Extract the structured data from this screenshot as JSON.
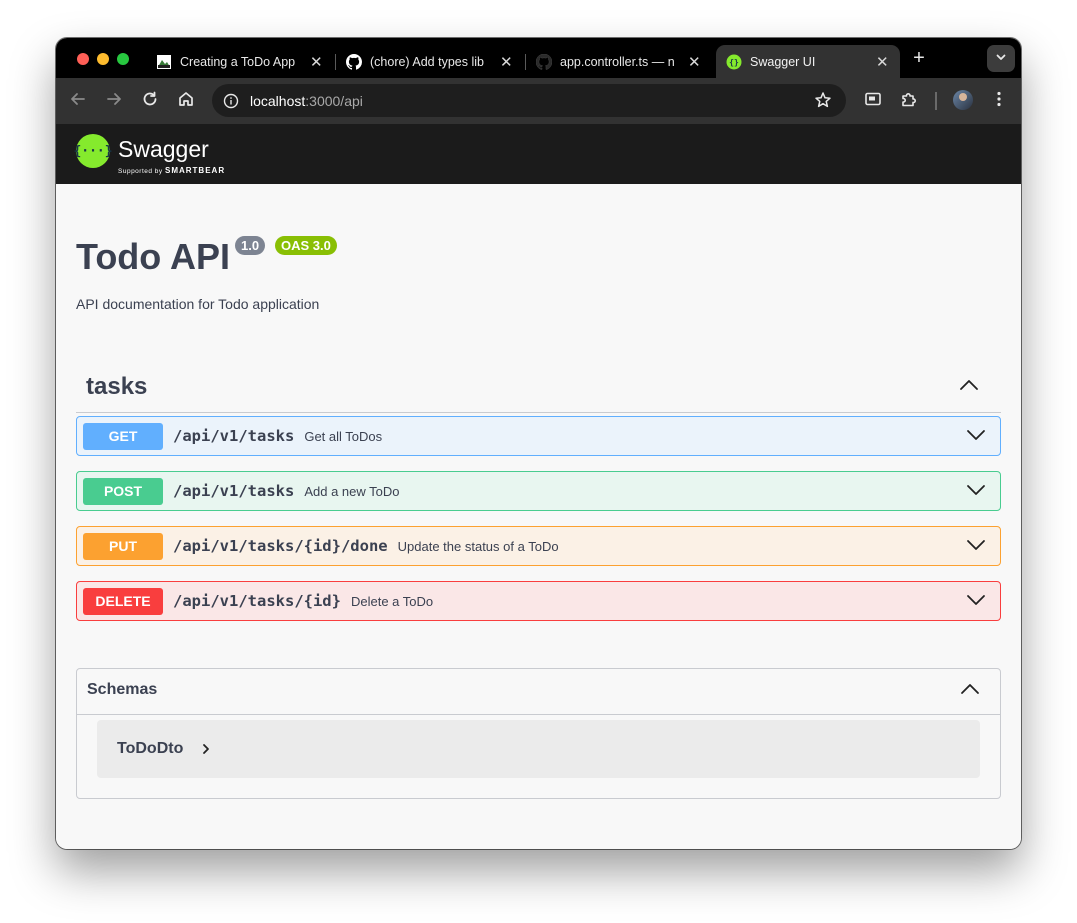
{
  "browser": {
    "tabs": [
      {
        "title": "Creating a ToDo App",
        "favicon": "app-favicon-icon"
      },
      {
        "title": "(chore) Add types lib",
        "favicon": "github-icon"
      },
      {
        "title": "app.controller.ts — n",
        "favicon": "github-icon"
      },
      {
        "title": "Swagger UI",
        "favicon": "swagger-favicon-icon",
        "active": true
      }
    ],
    "new_tab_label": "+",
    "close_glyph": "✕",
    "url": {
      "host": "localhost",
      "rest": ":3000/api"
    }
  },
  "swagger_header": {
    "wordmark": "Swagger",
    "supported_by": "Supported by",
    "smartbear": "SMARTBEAR",
    "logo_glyph": "{···}"
  },
  "info": {
    "title": "Todo API",
    "version": "1.0",
    "oas": "OAS 3.0",
    "description": "API documentation for Todo application"
  },
  "tag": {
    "name": "tasks"
  },
  "operations": [
    {
      "method": "GET",
      "path": "/api/v1/tasks",
      "summary": "Get all ToDos",
      "color": "#61affe"
    },
    {
      "method": "POST",
      "path": "/api/v1/tasks",
      "summary": "Add a new ToDo",
      "color": "#49cc90"
    },
    {
      "method": "PUT",
      "path": "/api/v1/tasks/{id}/done",
      "summary": "Update the status of a ToDo",
      "color": "#fca130"
    },
    {
      "method": "DELETE",
      "path": "/api/v1/tasks/{id}",
      "summary": "Delete a ToDo",
      "color": "#f93e3e"
    }
  ],
  "schemas": {
    "title": "Schemas",
    "models": [
      "ToDoDto"
    ]
  },
  "colors": {
    "swagger_green": "#85ea2d",
    "text": "#3b4151"
  }
}
